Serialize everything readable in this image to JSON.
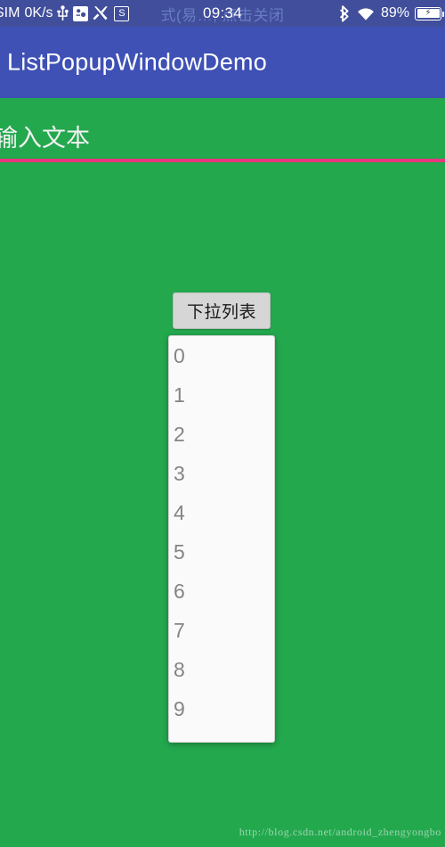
{
  "statusbar": {
    "carrier": "SIM",
    "netspeed": "0K/s",
    "usb_icon": "usb-icon",
    "sync_icon": "sync-icon",
    "tools_icon": "tools-icon",
    "s_icon": "s-badge-icon",
    "ghost_text": "式(易…,  点击关闭",
    "clock": "09:34",
    "bluetooth_icon": "bluetooth-icon",
    "wifi_icon": "wifi-icon",
    "battery_percent": "89%",
    "battery_charging_icon": "charging-bolt-icon"
  },
  "appbar": {
    "title": "ListPopupWindowDemo"
  },
  "edittext": {
    "value": "",
    "placeholder": "输入文本"
  },
  "button": {
    "label": "下拉列表"
  },
  "popup_list": {
    "items": [
      "0",
      "1",
      "2",
      "3",
      "4",
      "5",
      "6",
      "7",
      "8",
      "9"
    ]
  },
  "watermark": {
    "text": "http://blog.csdn.net/android_zhengyongbo"
  },
  "colors": {
    "statusbar_bg": "#404E9B",
    "appbar_bg": "#3F51B5",
    "content_bg": "#23A84E",
    "underline": "#E8377F",
    "button_bg": "#D6D6D6",
    "popup_bg": "#FAFAFA",
    "popup_text": "#848484"
  }
}
